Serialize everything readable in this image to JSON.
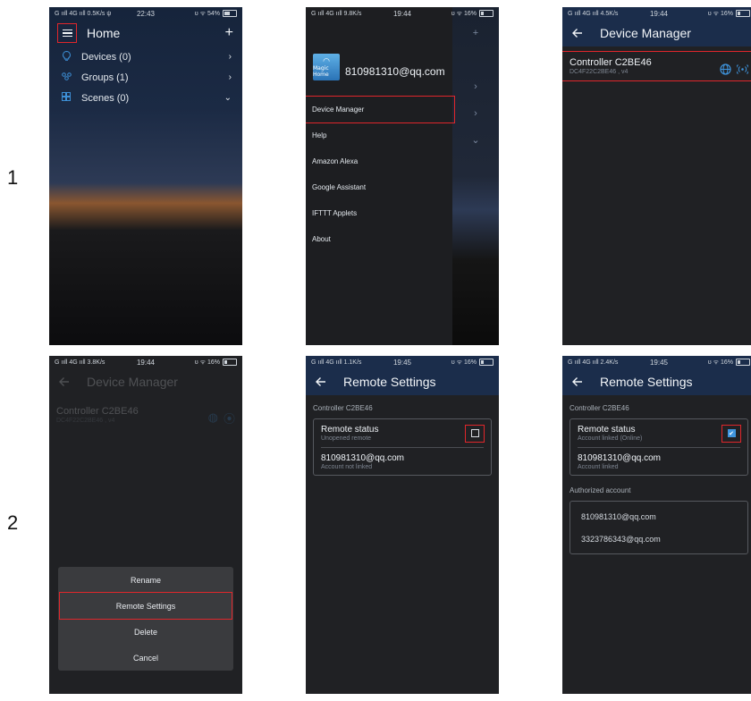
{
  "row_labels": [
    "1",
    "2"
  ],
  "phone1": {
    "status": {
      "left": "G ııll 4G ııll 0.5K/s ψ",
      "time": "22:43",
      "right": "ʊ ᯤ 54%"
    },
    "title": "Home",
    "add": "+",
    "items": [
      {
        "label": "Devices (0)",
        "icon": "bulb-icon",
        "chev": "›"
      },
      {
        "label": "Groups (1)",
        "icon": "groups-icon",
        "chev": "›"
      },
      {
        "label": "Scenes (0)",
        "icon": "scenes-icon",
        "chev": "⌄"
      }
    ]
  },
  "phone2": {
    "status": {
      "left": "G ııll 4G ııll 9.8K/s",
      "time": "19:44",
      "right": "ʊ ᯤ 16%"
    },
    "logo_text": "Magic Home",
    "email": "810981310@qq.com",
    "items": [
      "Device Manager",
      "Help",
      "Amazon Alexa",
      "Google Assistant",
      "IFTTT Applets",
      "About"
    ],
    "side_marks": [
      "+",
      "›",
      "›",
      "⌄"
    ]
  },
  "phone3": {
    "status": {
      "left": "G ııll 4G ııll 4.5K/s",
      "time": "19:44",
      "right": "ʊ ᯤ 16%"
    },
    "title": "Device Manager",
    "controller_name": "Controller  C2BE46",
    "controller_sub": "DC4F22C2BE46 , v4"
  },
  "phone4": {
    "status": {
      "left": "G ııll 4G ııll 3.8K/s",
      "time": "19:44",
      "right": "ʊ ᯤ 16%"
    },
    "title": "Device Manager",
    "controller_name": "Controller  C2BE46",
    "controller_sub": "DC4F22C2BE46 , v4",
    "sheet": [
      "Rename",
      "Remote Settings",
      "Delete",
      "Cancel"
    ]
  },
  "phone5": {
    "status": {
      "left": "G ııll 4G ııll 1.1K/s",
      "time": "19:45",
      "right": "ʊ ᯤ 16%"
    },
    "title": "Remote Settings",
    "caption": "Controller  C2BE46",
    "remote_status": "Remote status",
    "remote_sub": "Unopened remote",
    "account": "810981310@qq.com",
    "account_sub": "Account not linked"
  },
  "phone6": {
    "status": {
      "left": "G ııll 4G ııll 2.4K/s",
      "time": "19:45",
      "right": "ʊ ᯤ 16%"
    },
    "title": "Remote Settings",
    "caption": "Controller  C2BE46",
    "remote_status": "Remote status",
    "remote_sub": "Account linked (Online)",
    "account": "810981310@qq.com",
    "account_sub": "Account linked",
    "auth_caption": "Authorized account",
    "authorized": [
      "810981310@qq.com",
      "3323786343@qq.com"
    ]
  },
  "colors": {
    "accent": "#3f95de",
    "highlight": "#e0262b",
    "topbar": "#1b2d4b"
  }
}
